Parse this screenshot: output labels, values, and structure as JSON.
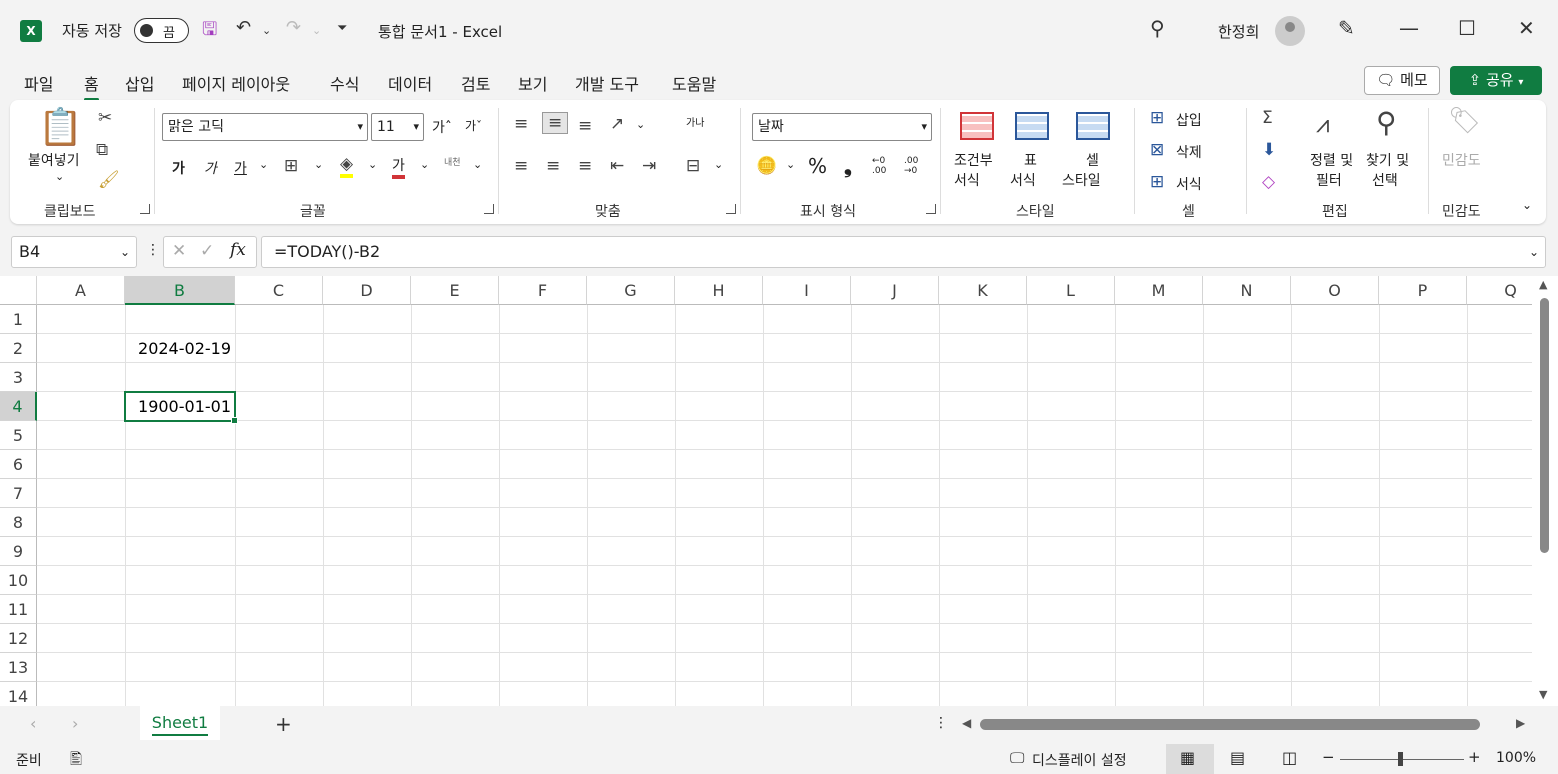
{
  "titlebar": {
    "autosave_label": "자동 저장",
    "autosave_state": "끔",
    "doc_title": "통합 문서1  -  Excel",
    "user_name": "한정희"
  },
  "tabs": [
    "파일",
    "홈",
    "삽입",
    "페이지 레이아웃",
    "수식",
    "데이터",
    "검토",
    "보기",
    "개발 도구",
    "도움말"
  ],
  "active_tab": "홈",
  "actions": {
    "memo": "메모",
    "share": "공유"
  },
  "ribbon": {
    "clipboard": {
      "paste": "붙여넣기",
      "group": "클립보드"
    },
    "font": {
      "name": "맑은 고딕",
      "size": "11",
      "grow": "가ˆ",
      "shrink": "가ˇ",
      "bold": "가",
      "italic": "가",
      "underline": "가",
      "color_letter": "가",
      "phonetic": "내천",
      "group": "글꼴"
    },
    "align": {
      "wrap": "가나",
      "group": "맞춤"
    },
    "number": {
      "format": "날짜",
      "percent": "%",
      "comma": "❟",
      "inc": "←0 .00",
      "dec": ".00 →0",
      "group": "표시 형식"
    },
    "styles": {
      "cond1": "조건부",
      "cond2": "서식",
      "table1": "표",
      "table2": "서식",
      "cell1": "셀",
      "cell2": "스타일",
      "group": "스타일"
    },
    "cells": {
      "insert": "삽입",
      "delete": "삭제",
      "format": "서식",
      "group": "셀"
    },
    "editing": {
      "sort1": "정렬 및",
      "sort2": "필터",
      "find1": "찾기 및",
      "find2": "선택",
      "group": "편집"
    },
    "sensitivity": {
      "label": "민감도",
      "group": "민감도"
    }
  },
  "formula_bar": {
    "name_box": "B4",
    "fx": "fx",
    "formula": "=TODAY()-B2"
  },
  "columns": [
    "A",
    "B",
    "C",
    "D",
    "E",
    "F",
    "G",
    "H",
    "I",
    "J",
    "K",
    "L",
    "M",
    "N",
    "O",
    "P",
    "Q"
  ],
  "rows": [
    "1",
    "2",
    "3",
    "4",
    "5",
    "6",
    "7",
    "8",
    "9",
    "10",
    "11",
    "12",
    "13",
    "14"
  ],
  "cells": {
    "B2": "2024-02-19",
    "B4": "1900-01-01"
  },
  "sheets": [
    "Sheet1"
  ],
  "status": {
    "ready": "준비",
    "display_settings": "디스플레이 설정",
    "zoom": "100%"
  },
  "colors": {
    "accent": "#107c41",
    "highlight_yellow": "#ffff00",
    "font_red": "#d13438"
  }
}
